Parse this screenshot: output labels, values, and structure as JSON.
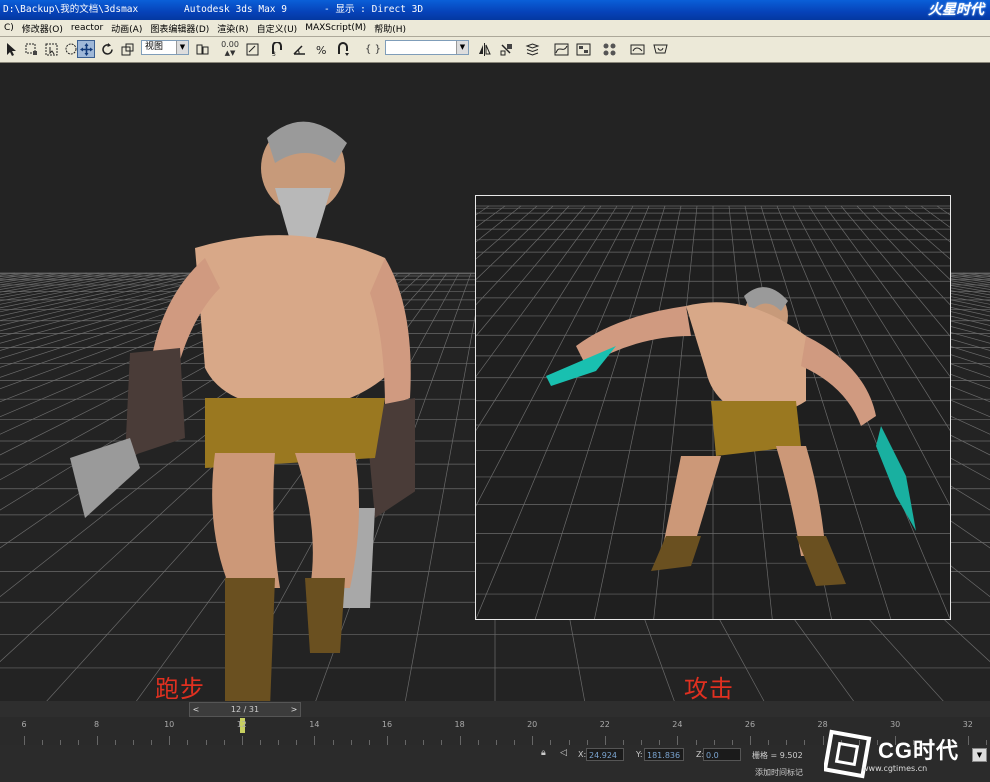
{
  "window": {
    "path": "D:\\Backup\\我的文档\\3dsmax",
    "app": "Autodesk 3ds Max 9",
    "display": "- 显示 : Direct 3D"
  },
  "watermark_top": "火星时代",
  "menu": [
    "C)",
    "修改器(O)",
    "reactor",
    "动画(A)",
    "图表编辑器(D)",
    "渲染(R)",
    "自定义(U)",
    "MAXScript(M)",
    "帮助(H)"
  ],
  "toolbar": {
    "view_select": "视图",
    "spinner_value": "0.00",
    "named_selection": ""
  },
  "viewport": {
    "caption_left": "跑步",
    "caption_right": "攻击"
  },
  "timeslider": {
    "frame": "12 / 31",
    "prev": "<",
    "next": ">"
  },
  "trackbar": {
    "ticks": [
      "6",
      "8",
      "10",
      "12",
      "14",
      "16",
      "18",
      "20",
      "22",
      "24",
      "26",
      "28",
      "30",
      "32"
    ],
    "current_frame": 12
  },
  "status": {
    "x_label": "X:",
    "x_value": "24.924",
    "y_label": "Y:",
    "y_value": "181.836",
    "z_label": "Z:",
    "z_value": "0.0",
    "grid": "栅格 = 9.502",
    "add_time_tag": "添加时间标记"
  },
  "watermark_bottom": {
    "brand": "CG时代",
    "url": "www.cgtimes.cn"
  }
}
